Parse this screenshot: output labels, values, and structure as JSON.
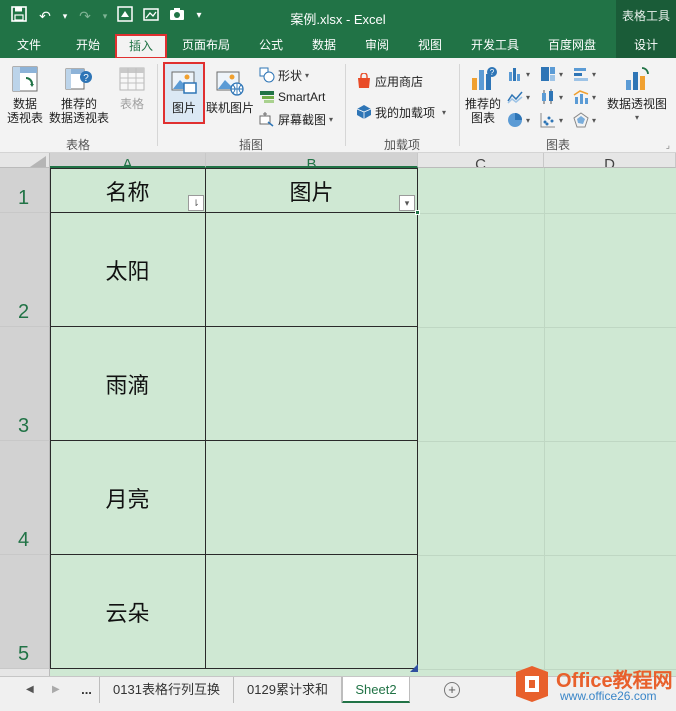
{
  "titlebar": {
    "document_title": "案例.xlsx - Excel",
    "tool_tab_group": "表格工具"
  },
  "tabs": [
    {
      "label": "文件"
    },
    {
      "label": "开始"
    },
    {
      "label": "插入"
    },
    {
      "label": "页面布局"
    },
    {
      "label": "公式"
    },
    {
      "label": "数据"
    },
    {
      "label": "审阅"
    },
    {
      "label": "视图"
    },
    {
      "label": "开发工具"
    },
    {
      "label": "百度网盘"
    },
    {
      "label": "设计"
    }
  ],
  "active_tab": "插入",
  "ribbon": {
    "tables": {
      "label": "表格",
      "pivot_line1": "数据",
      "pivot_line2": "透视表",
      "recpivot_line1": "推荐的",
      "recpivot_line2": "数据透视表",
      "table": "表格"
    },
    "illustrations": {
      "label": "插图",
      "pictures": "图片",
      "online_pictures": "联机图片",
      "shapes": "形状",
      "smartart": "SmartArt",
      "screenshot": "屏幕截图"
    },
    "addins": {
      "label": "加载项",
      "store": "应用商店",
      "my_addins": "我的加载项"
    },
    "charts": {
      "label": "图表",
      "recommended_line1": "推荐的",
      "recommended_line2": "图表",
      "pivotchart": "数据透视图"
    }
  },
  "sheet": {
    "columns": [
      "A",
      "B",
      "C",
      "D"
    ],
    "rows": [
      "1",
      "2",
      "3",
      "4",
      "5"
    ],
    "header": {
      "name": "名称",
      "picture": "图片"
    },
    "items": [
      {
        "name": "太阳"
      },
      {
        "name": "雨滴"
      },
      {
        "name": "月亮"
      },
      {
        "name": "云朵"
      }
    ]
  },
  "sheet_tabs": {
    "more": "...",
    "tabs": [
      {
        "label": "0131表格行列互换"
      },
      {
        "label": "0129累计求和"
      },
      {
        "label": "Sheet2"
      }
    ],
    "active": "Sheet2"
  },
  "watermark": {
    "brand": "Office教程网",
    "url": "www.office26.com"
  },
  "colors": {
    "excel_green": "#217346",
    "selection_fill": "#cfe8d3",
    "highlight_red": "#e03030"
  }
}
